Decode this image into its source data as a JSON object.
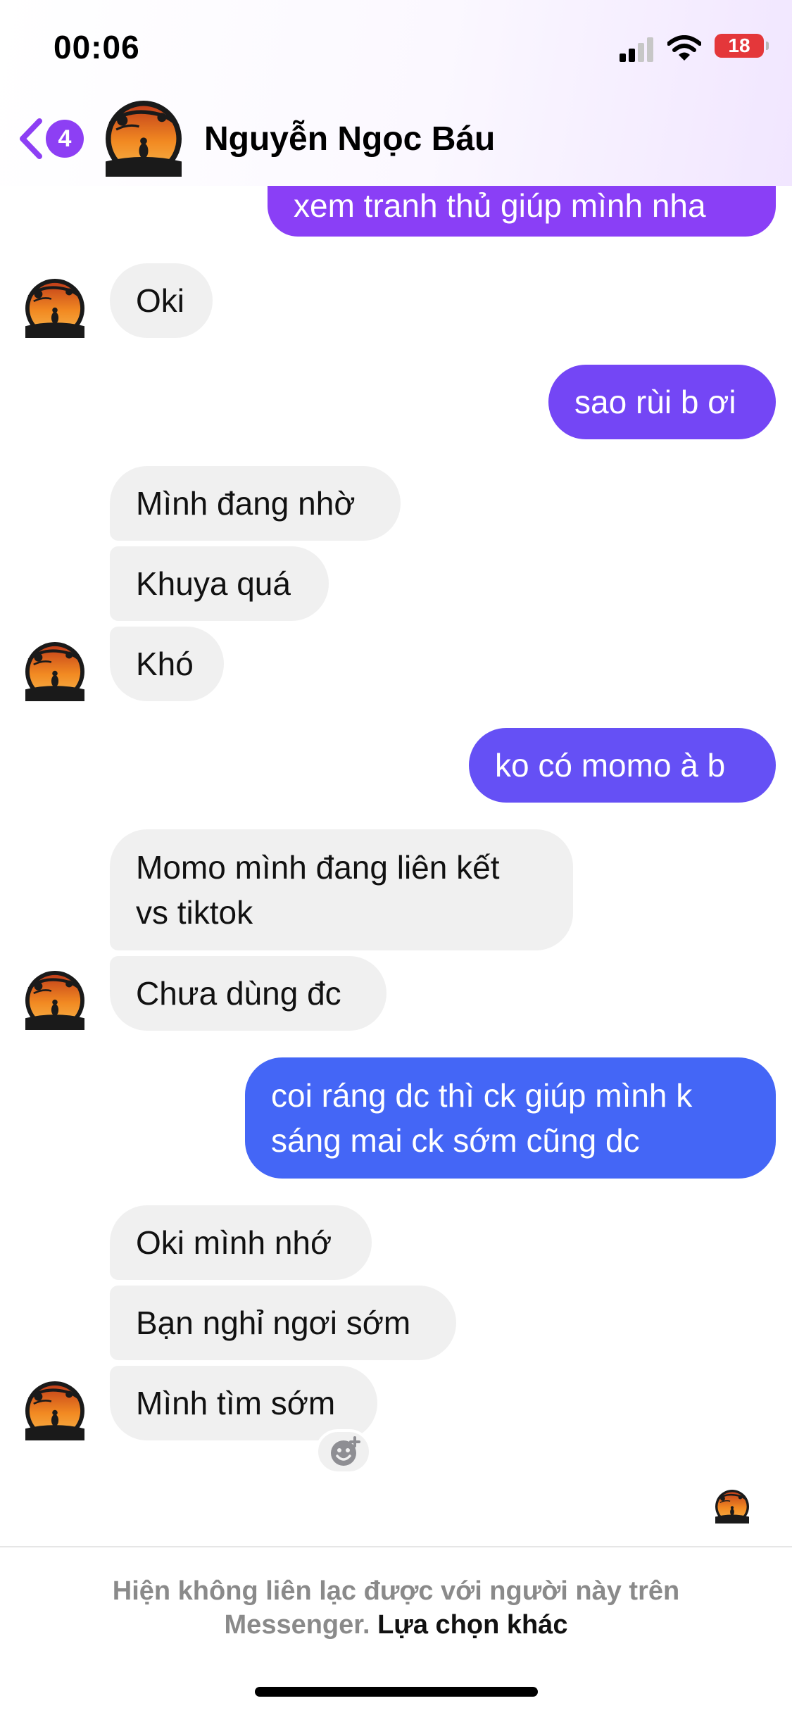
{
  "status_bar": {
    "time": "00:06",
    "battery": "18"
  },
  "header": {
    "back_badge": "4",
    "contact_name": "Nguyễn Ngọc Báu"
  },
  "colors": {
    "accent": "#8d3ff4",
    "bubble_out_top": "#8a3ff6",
    "bubble_out_mid": "#6a4cf5",
    "bubble_out_bottom": "#4466f6",
    "bubble_in": "#f0f0f0"
  },
  "messages": [
    {
      "side": "out",
      "text": "xem tranh thủ giúp mình nha"
    },
    {
      "side": "in",
      "text": "Oki"
    },
    {
      "side": "out",
      "text": "sao rùi b ơi"
    },
    {
      "side": "in",
      "text": "Mình đang nhờ"
    },
    {
      "side": "in",
      "text": "Khuya quá"
    },
    {
      "side": "in",
      "text": "Khó"
    },
    {
      "side": "out",
      "text": "ko có momo à b"
    },
    {
      "side": "in",
      "lines": [
        "Momo mình đang liên kết",
        "vs tiktok"
      ]
    },
    {
      "side": "in",
      "text": "Chưa dùng đc"
    },
    {
      "side": "out",
      "lines": [
        "coi ráng dc thì ck giúp mình k",
        "sáng mai ck sớm cũng dc"
      ]
    },
    {
      "side": "in",
      "text": "Oki mình nhớ"
    },
    {
      "side": "in",
      "text": "Bạn nghỉ ngơi sớm"
    },
    {
      "side": "in",
      "text": "Mình tìm sớm"
    }
  ],
  "icons": {
    "back": "chevron-left-icon",
    "signal": "signal-icon",
    "wifi": "wifi-icon",
    "react": "add-reaction-icon"
  },
  "footer": {
    "notice": "Hiện không liên lạc được với người này trên",
    "notice_line2": "Messenger.",
    "link": "Lựa chọn khác"
  }
}
